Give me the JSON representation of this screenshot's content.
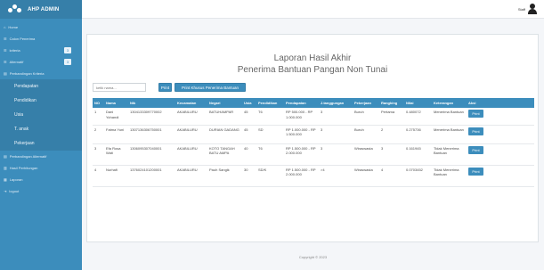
{
  "brand": {
    "title": "AHP ADMIN"
  },
  "sidebar": {
    "items": [
      {
        "label": "Home",
        "icon": "home-icon"
      },
      {
        "label": "Calon Penerima",
        "icon": "users-icon"
      },
      {
        "label": "kriteria",
        "icon": "list-icon",
        "badge": "3"
      },
      {
        "label": "Alternatif",
        "icon": "list-icon",
        "badge": "3"
      },
      {
        "label": "Perbandingan Kriteria",
        "icon": "compare-icon"
      }
    ],
    "submenu": [
      "Pendapatan",
      "Pendidikan",
      "Usia",
      "T. anak",
      "Pekerjaan"
    ],
    "items_after": [
      {
        "label": "Perbandingan Alternatif",
        "icon": "compare-icon"
      },
      {
        "label": "Hasil Perhitungan",
        "icon": "chart-icon"
      },
      {
        "label": "Laporan",
        "icon": "report-icon"
      },
      {
        "label": "logout",
        "icon": "logout-icon"
      }
    ]
  },
  "topbar": {
    "user": "Staff"
  },
  "report": {
    "title_line1": "Laporan Hasil Akhir",
    "title_line2": "Penerima Bantuan Pangan Non Tunai"
  },
  "toolbar": {
    "search_placeholder": "ketik nama...",
    "print_label": "Print",
    "print_khusus_label": "Print Khusus Penerima Bantuan"
  },
  "table": {
    "headers": [
      "NO",
      "Nama",
      "Nik",
      "Kecamatan",
      "Negari",
      "Usia",
      "Pendidikan",
      "Pendapatan",
      "J.tanggungan",
      "Pekerjaan",
      "Rangking",
      "Nilai",
      "Keterangan",
      "Aksi"
    ],
    "rows": [
      [
        "1",
        "Dani Yohandi",
        "1304133309770002",
        "AKABILURU",
        "BATUHAMPAR",
        "45",
        "T6",
        "RP 500.000 - RP 1.000.000",
        "3",
        "Buruh",
        "Pertama",
        "0.480072",
        "Menerima Bantuan",
        "Print"
      ],
      [
        "2",
        "Fatma Yuni",
        "1307136306750001",
        "AKABILURU",
        "DURIAN GADANG",
        "45",
        "SD",
        "RP 1.000.000 - RP 1.500.000",
        "3",
        "Buruh",
        "2",
        "0.275736",
        "Menerima Bantuan",
        "Print"
      ],
      [
        "3",
        "Efa Rosa Wati",
        "1306095307040001",
        "AKABILURU",
        "KOTO TANGAH BATU AMPA",
        "40",
        "T6",
        "RP 1.500.000 - RP 2.000.000",
        "3",
        "Wiraswasta",
        "3",
        "0.161945",
        "Tidak Menerima Bantuan",
        "Print"
      ],
      [
        "4",
        "Nurhafi",
        "1376024101200001",
        "AKABILURU",
        "Pauh Sangik",
        "30",
        "SD/K",
        "RP 1.500.000 - RP 2.000.000",
        ">4",
        "Wiraswasta",
        "4",
        "0.0703452",
        "Tidak Menerima Bantuan",
        "Print"
      ]
    ]
  },
  "footer": {
    "text": "Copyright © 2023"
  },
  "colors": {
    "primary": "#3c8dbc",
    "primary_dark": "#367fa9"
  }
}
